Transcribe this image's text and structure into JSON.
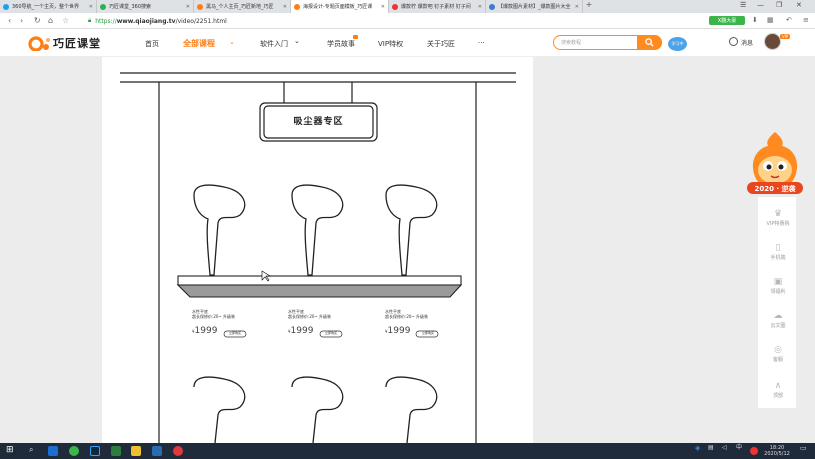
{
  "browser": {
    "tabs": [
      {
        "label": "360导航_一个主页，整个世界",
        "color": "#1aa3e8",
        "active": false
      },
      {
        "label": "巧匠课堂_360搜索",
        "color": "#2bb24c",
        "active": false
      },
      {
        "label": "黑马_个人主页_巧匠新地_巧匠",
        "color": "#ff7e14",
        "active": false
      },
      {
        "label": "海报设计-专题页面模板_巧匠课",
        "color": "#ff7e14",
        "active": true
      },
      {
        "label": "爆款柠 爆款吧 钉子素材 钉子间",
        "color": "#e33",
        "active": false
      },
      {
        "label": "【爆款图片素材】_爆款图片大全",
        "color": "#3a7bd5",
        "active": false
      }
    ],
    "new_tab": "+",
    "url_scheme": "https://",
    "url_host": "www.qiaojiang.tv",
    "url_path": "/video/2251.html",
    "ext_label": "X翻大豪",
    "window_controls": [
      "☰",
      "—",
      "❐",
      "✕"
    ]
  },
  "site": {
    "logo": "巧匠课堂",
    "nav": [
      "首页",
      "全部课程",
      "软件入门",
      "学员故事",
      "VIP特权",
      "关于巧匠",
      "···"
    ],
    "search_placeholder": "搜索教程",
    "user_badge": "学习中",
    "messages": "消息",
    "vip_tag": "VIP"
  },
  "poster": {
    "sign": "吸尘器专区",
    "products": [
      {
        "line1": "水性平底",
        "line2": "超长保修价:20~ 升级装",
        "price": "1999",
        "btn": "立即购买"
      },
      {
        "line1": "水性平底",
        "line2": "超长保修价:20~ 升级装",
        "price": "1999",
        "btn": "立即购买"
      },
      {
        "line1": "水性平底",
        "line2": "超长保修价:20~ 升级装",
        "price": "1999",
        "btn": "立即购买"
      }
    ],
    "price_prefix": "¥"
  },
  "sidebar": {
    "mascot_badge": "2020 · 逆袭",
    "items": [
      {
        "label": "VIP特惠购",
        "icon": "crown-icon",
        "glyph": "♛"
      },
      {
        "label": "手机端",
        "icon": "phone-icon",
        "glyph": "▯"
      },
      {
        "label": "领福利",
        "icon": "gift-icon",
        "glyph": "▣"
      },
      {
        "label": "云文图",
        "icon": "cloud-icon",
        "glyph": "☁"
      },
      {
        "label": "客服",
        "icon": "headset-icon",
        "glyph": "◎"
      },
      {
        "label": "顶部",
        "icon": "top-arrow-icon",
        "glyph": "∧"
      }
    ]
  },
  "taskbar": {
    "time": "18:20",
    "date": "2020/5/12"
  },
  "colors": {
    "brand": "#ff7e14",
    "accent_green": "#3bb54a",
    "taskbar": "#1f2b3a"
  }
}
